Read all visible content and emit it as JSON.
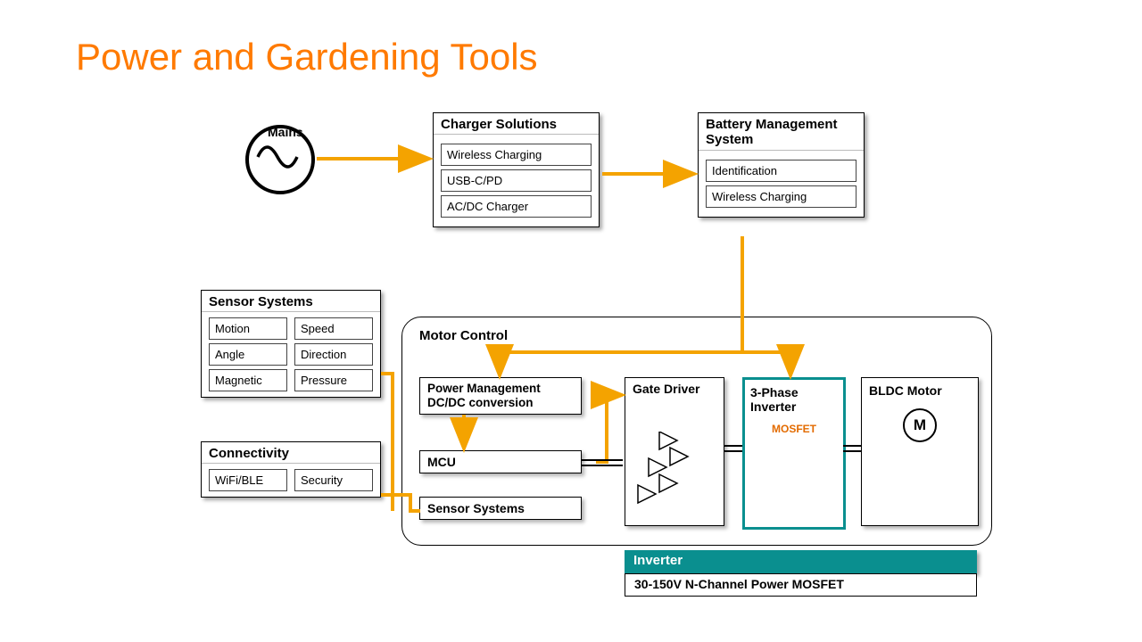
{
  "title": "Power and Gardening Tools",
  "mains": {
    "label": "Mains"
  },
  "charger": {
    "header": "Charger Solutions",
    "items": [
      "Wireless Charging",
      "USB-C/PD",
      "AC/DC Charger"
    ]
  },
  "bms": {
    "header": "Battery Management System",
    "items": [
      "Identification",
      "Wireless Charging"
    ]
  },
  "sensors": {
    "header": "Sensor Systems",
    "items": [
      "Motion",
      "Speed",
      "Angle",
      "Direction",
      "Magnetic",
      "Pressure"
    ]
  },
  "connectivity": {
    "header": "Connectivity",
    "items": [
      "WiFi/BLE",
      "Security"
    ]
  },
  "motor_control": {
    "label": "Motor Control",
    "pm_label": "Power Management DC/DC conversion",
    "mcu_label": "MCU",
    "sensor_label": "Sensor Systems",
    "gate_label": "Gate Driver",
    "inverter_label": "3-Phase Inverter",
    "mosfet_label": "MOSFET",
    "bldc_label": "BLDC Motor",
    "m_letter": "M"
  },
  "inverter_footer": {
    "header": "Inverter",
    "body": "30-150V N-Channel Power MOSFET"
  }
}
